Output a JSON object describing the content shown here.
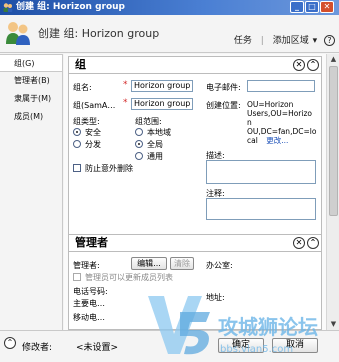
{
  "window": {
    "title": "创建 组: Horizon group",
    "min_glyph": "_",
    "max_glyph": "□",
    "close_glyph": "✕"
  },
  "header": {
    "title": "创建 组: Horizon group",
    "toolbar": {
      "tasks": "任务",
      "separator": "|",
      "add_section": "添加区域",
      "add_section_arrow": "▾",
      "help": "?"
    }
  },
  "sidebar": {
    "items": [
      {
        "label": "组(G)"
      },
      {
        "label": "管理者(B)"
      },
      {
        "label": "隶属于(M)"
      },
      {
        "label": "成员(M)"
      }
    ]
  },
  "group_section": {
    "title": "组",
    "close_glyph": "✕",
    "collapse_glyph": "⌃",
    "name_label": "组名:",
    "name_value": "Horizon group",
    "sam_label": "组(SamA…",
    "sam_value": "Horizon group",
    "required_mark": "*",
    "type_label": "组类型:",
    "type_options": [
      "安全",
      "分发"
    ],
    "scope_label": "组范围:",
    "scope_options": [
      "本地域",
      "全局",
      "通用"
    ],
    "protect_label": "防止意外删除",
    "email_label": "电子邮件:",
    "email_value": "",
    "location_label": "创建位置:",
    "location_value_lines": [
      "OU=Horizon",
      "Users,OU=Horizo",
      "n",
      "OU,DC=fan,DC=lo",
      "cal"
    ],
    "change_link": "更改...",
    "description_label": "描述:",
    "notes_label": "注释:"
  },
  "manager_section": {
    "title": "管理者",
    "close_glyph": "✕",
    "collapse_glyph": "⌃",
    "manager_label": "管理者:",
    "edit_button": "编辑...",
    "clear_button": "清除",
    "can_update_label": "管理员可以更新成员列表",
    "phone_label": "电话号码:",
    "main_phone_label": "主要电…",
    "mobile_label": "移动电…",
    "office_label": "办公室:",
    "address_label": "地址:"
  },
  "footer": {
    "collapse_glyph": "⌃",
    "modifier_label": "修改者:",
    "modifier_value": "<未设置>",
    "ok_button": "确定",
    "cancel_button": "取消"
  },
  "watermark": {
    "brand": "攻城狮论坛",
    "url": "bbs.vlan5.com"
  }
}
